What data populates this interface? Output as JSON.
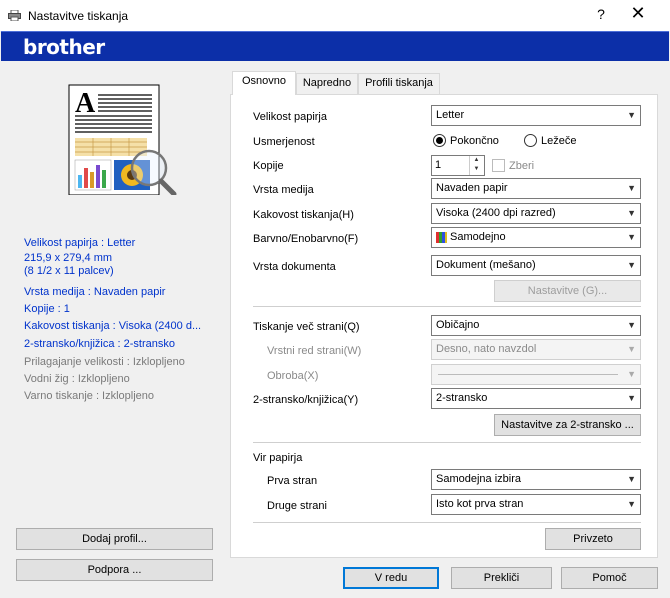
{
  "window": {
    "title": "Nastavitve tiskanja",
    "help_label": "?",
    "close_label": "✕"
  },
  "brand": {
    "logo": "brother",
    "color": "#0c2fa8"
  },
  "summary": {
    "paper_size": "Velikost papirja : Letter",
    "paper_dims_mm": "215,9 x 279,4 mm",
    "paper_dims_in": "(8 1/2 x 11 palcev)",
    "media": "Vrsta medija : Navaden papir",
    "copies": "Kopije : 1",
    "quality": "Kakovost tiskanja : Visoka (2400 d...",
    "duplex": "2-stransko/knjižica : 2-stransko",
    "fit": "Prilagajanje velikosti : Izklopljeno",
    "watermark": "Vodni žig : Izklopljeno",
    "secure": "Varno tiskanje : Izklopljeno"
  },
  "left_buttons": {
    "add_profile": "Dodaj profil...",
    "support": "Podpora ..."
  },
  "tabs": [
    {
      "label": "Osnovno",
      "active": true
    },
    {
      "label": "Napredno",
      "active": false
    },
    {
      "label": "Profili tiskanja",
      "active": false
    }
  ],
  "basic": {
    "paper_size": {
      "label": "Velikost papirja",
      "value": "Letter"
    },
    "orientation": {
      "label": "Usmerjenost",
      "portrait": "Pokončno",
      "landscape": "Ležeče",
      "selected": "portrait"
    },
    "copies": {
      "label": "Kopije",
      "value": "1",
      "collate": "Zberi"
    },
    "media": {
      "label": "Vrsta medija",
      "value": "Navaden papir"
    },
    "quality": {
      "label": "Kakovost tiskanja(H)",
      "value": "Visoka (2400 dpi razred)"
    },
    "color": {
      "label": "Barvno/Enobarvno(F)",
      "value": "Samodejno"
    },
    "doc_type": {
      "label": "Vrsta dokumenta",
      "value": "Dokument (mešano)"
    },
    "doc_settings_button": "Nastavitve (G)...",
    "multipage": {
      "label": "Tiskanje več strani(Q)",
      "value": "Običajno"
    },
    "page_order": {
      "label": "Vrstni red strani(W)",
      "value": "Desno, nato navzdol"
    },
    "border": {
      "label": "Obroba(X)",
      "value": ""
    },
    "duplex": {
      "label": "2-stransko/knjižica(Y)",
      "value": "2-stransko"
    },
    "duplex_settings_button": "Nastavitve za 2-stransko ...",
    "source": {
      "label": "Vir papirja",
      "first": {
        "label": "Prva stran",
        "value": "Samodejna izbira"
      },
      "other": {
        "label": "Druge strani",
        "value": "Isto kot prva stran"
      }
    },
    "default_button": "Privzeto"
  },
  "footer": {
    "ok": "V redu",
    "cancel": "Prekliči",
    "help": "Pomoč"
  }
}
